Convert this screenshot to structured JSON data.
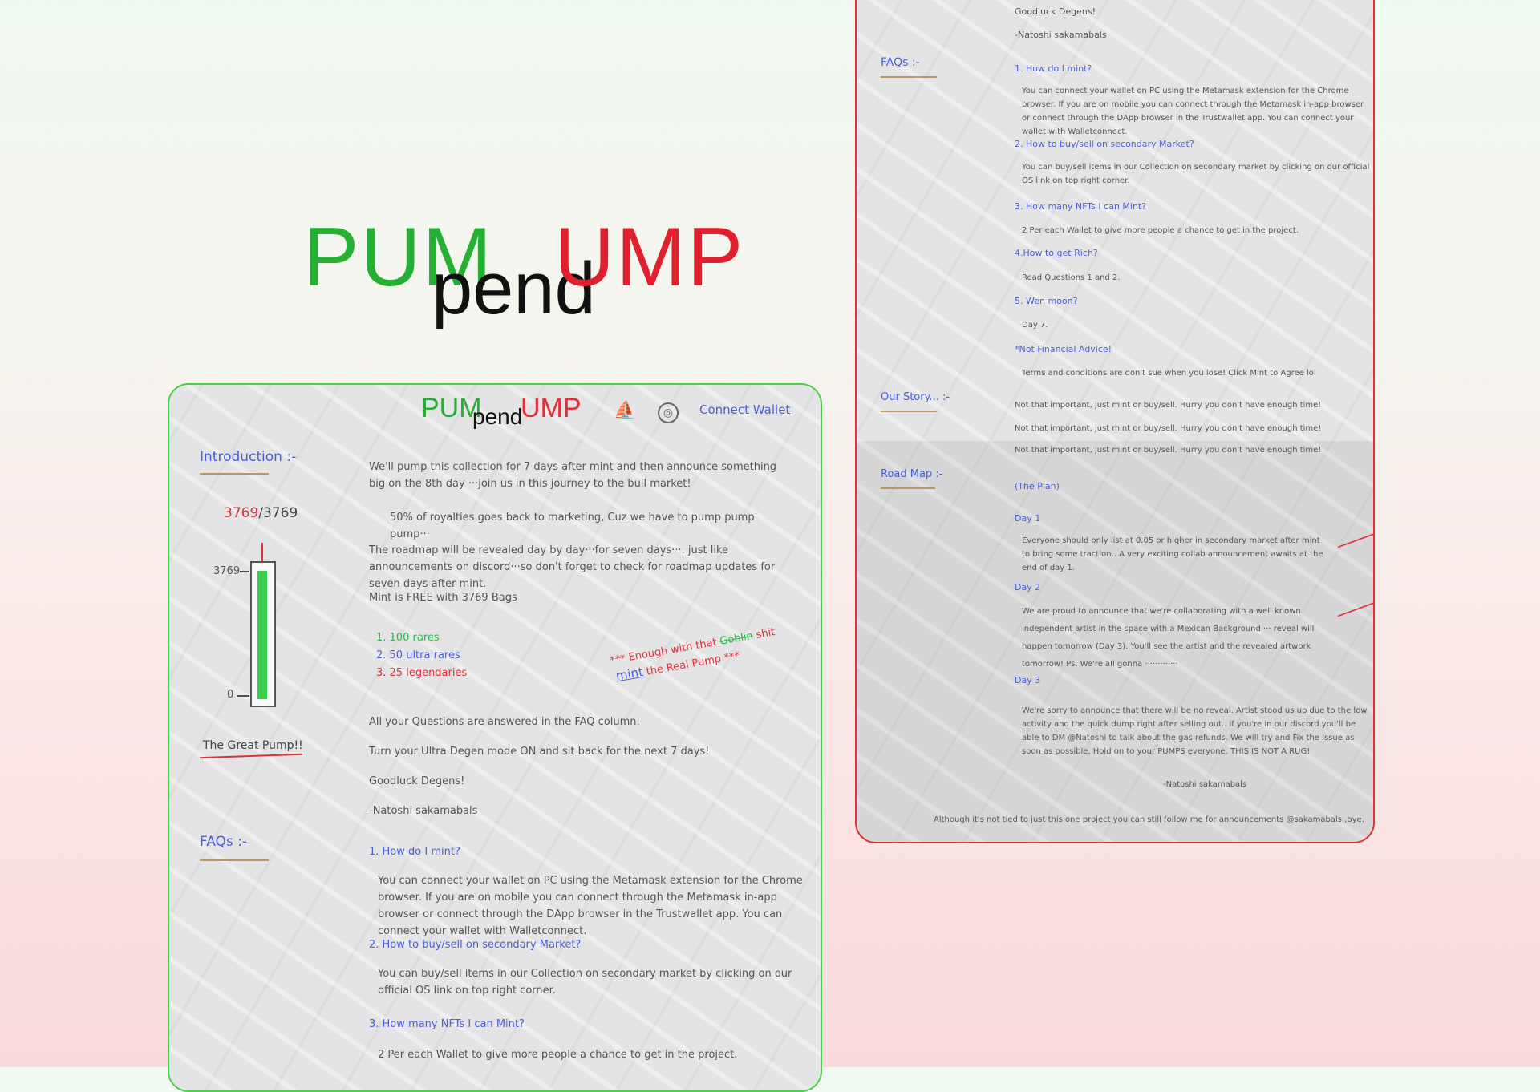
{
  "hero": {
    "pum": "PUM",
    "pend": "pend",
    "ump": "UMP"
  },
  "nav": {
    "connect_wallet": "Connect Wallet"
  },
  "intro": {
    "heading": "Introduction :-",
    "minted": "3769",
    "supply": "/3769",
    "gauge_top_label": "3769",
    "gauge_bottom_label": "0",
    "gauge_fill_fraction": 1.0,
    "caption": "The Great Pump!!",
    "p1": "We'll pump this collection for 7 days after mint and then announce something big on the 8th day ···join us in this journey to the bull market!",
    "p2": "50% of royalties goes back to marketing, Cuz we have to pump pump pump···",
    "p3": "The roadmap will be revealed day by day···for seven days···. just like announcements on discord···so don't forget to check for roadmap updates for seven days after mint.",
    "p4": "Mint is FREE with 3769 Bags",
    "rarity": [
      "1. 100 rares",
      "2. 50 ultra rares",
      "3. 25 legendaries"
    ],
    "scribble1a": "*** Enough with that ",
    "scribble1b": "Goblin",
    "scribble1c": " shit",
    "scribble2a": "mint",
    "scribble2b": " the Real Pump ***",
    "p5": "All your Questions are answered in the FAQ column.",
    "p6": "Turn your Ultra Degen mode ON and sit back for the next 7 days!",
    "p7": "Goodluck Degens!",
    "p8": "-Natoshi sakamabals"
  },
  "faqs": {
    "heading": "FAQs :-",
    "q1": "1. How do I mint?",
    "a1": "You can connect your wallet on PC using the Metamask extension for the Chrome browser. If you are on mobile you can connect through the Metamask in-app browser or connect through the DApp browser in the Trustwallet app. You can connect your wallet with Walletconnect.",
    "q2": "2. How to buy/sell on secondary Market?",
    "a2": "You can buy/sell items in our Collection on secondary market by clicking on our official OS link on top right corner.",
    "q3": "3. How many NFTs I can Mint?",
    "a3": "2 Per each Wallet to give more people a chance to get in the project.",
    "q4": "4.How to get Rich?",
    "a4": "Read Questions 1 and 2.",
    "q5": "5. Wen moon?",
    "a5": "Day 7.",
    "q6": "*Not Financial Advice!",
    "a6": "Terms and conditions are don't sue when you lose! Click Mint to Agree lol"
  },
  "story": {
    "heading": "Our Story... :-",
    "line": "Not that important, just mint or buy/sell. Hurry you don't have enough time"
  },
  "roadmap": {
    "heading": "Road Map :-",
    "plan": "(The Plan)",
    "day1": "Day 1",
    "day1_text": "Everyone should only list at 0.05 or higher in secondary market after mint to bring some traction.. A very exciting collab announcement awaits at the end of day 1.",
    "day2": "Day 2",
    "day2_text": "We are proud to announce that we're collaborating with a well known independent artist in the space with a Mexican Background ··· reveal will happen tomorrow (Day 3). You'll see the artist and the revealed artwork tomorrow! Ps. We're all gonna ·············",
    "day3": "Day 3",
    "day3_text": "We're sorry to announce that there will be no reveal. Artist stood us up due to the low activity and the quick dump right after selling out.. if you're in our discord you'll be able to DM @Natoshi to talk about the gas refunds. We will try and Fix the Issue as soon as possible. Hold on to your PUMPS everyone, THIS IS NOT A RUG!",
    "sign": "-Natoshi sakamabals",
    "footer": "Although it's not tied to just this one project you can still follow me for announcements @sakamabals ,bye."
  },
  "colors": {
    "green": "#2db84b",
    "red": "#e0303a",
    "blue": "#4a5fd6"
  }
}
